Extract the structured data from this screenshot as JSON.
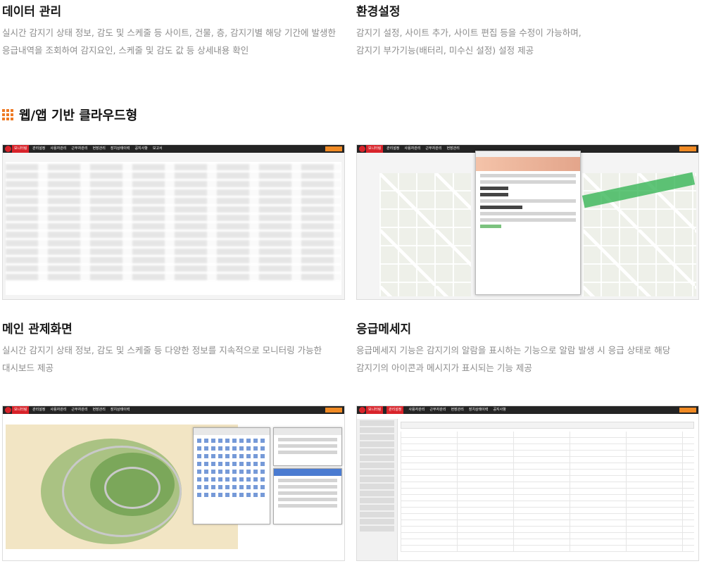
{
  "features": [
    {
      "title": "데이터 관리",
      "desc_lines": [
        "실시간 감지기 상태 정보, 감도 및 스케줄 등 사이트, 건물, 층, 감지기별 해당 기간에 발생한",
        "응급내역을 조회하여 감지요인, 스케줄 및 감도 값 등 상세내용 확인"
      ]
    },
    {
      "title": "환경설정",
      "desc_lines": [
        "감지기 설정, 사이트 추가, 사이트 편집 등을 수정이 가능하며,",
        "감지기 부가기능(배터리, 미수신 설정) 설정 제공"
      ]
    },
    {
      "title": "메인 관제화면",
      "desc_lines": [
        "실시간 감지기 상태 정보, 감도 및 스케줄 등 다양한 정보를 지속적으로 모니터링 가능한",
        "대시보드 제공"
      ]
    },
    {
      "title": "응급메세지",
      "desc_lines": [
        "응급메세지 기능은 감지기의 알람을 표시하는 기능으로 알람 발생 시 응급 상태로 해당",
        "감지기의 아이콘과 메시지가 표시되는 기능 제공"
      ]
    }
  ],
  "section": {
    "title": "웹/앱 기반 클라우드형",
    "icon": "grid-icon",
    "accent": "#ee7a24"
  },
  "mini_app": {
    "brand": "모니터링",
    "menu": [
      "관리설정",
      "사용자관리",
      "근무자관리",
      "현장관리",
      "장치상태이력",
      "공지사항",
      "보고서"
    ],
    "nav_color": "#242424",
    "brand_color": "#d8232a"
  }
}
